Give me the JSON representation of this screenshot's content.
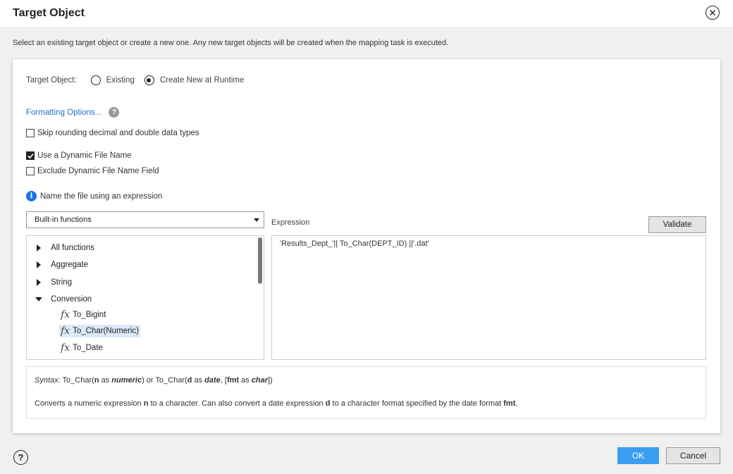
{
  "dialog": {
    "title": "Target Object",
    "description": "Select an existing target object or create a new one. Any new target objects will be created when the mapping task is executed."
  },
  "target_object": {
    "label": "Target Object:",
    "options": [
      {
        "label": "Existing",
        "checked": false
      },
      {
        "label": "Create New at Runtime",
        "checked": true
      }
    ]
  },
  "formatting": {
    "link_label": "Formatting Options...",
    "help_glyph": "?"
  },
  "checkboxes": {
    "skip_rounding": {
      "label": "Skip rounding decimal and double data types",
      "checked": false
    },
    "dynamic_file_name": {
      "label": "Use a Dynamic File Name",
      "checked": true
    },
    "exclude_dynamic": {
      "label": "Exclude Dynamic File Name Field",
      "checked": false
    }
  },
  "info": {
    "icon_glyph": "i",
    "text": "Name the file using an expression"
  },
  "functions": {
    "selected": "Built-in functions",
    "tree": [
      {
        "label": "All functions",
        "expanded": false
      },
      {
        "label": "Aggregate",
        "expanded": false
      },
      {
        "label": "String",
        "expanded": false
      },
      {
        "label": "Conversion",
        "expanded": true
      }
    ],
    "fx_glyph": "fx",
    "items": [
      {
        "label": "To_Bigint",
        "selected": false
      },
      {
        "label": "To_Char(Numeric)",
        "selected": true
      },
      {
        "label": "To_Date",
        "selected": false
      }
    ]
  },
  "expression": {
    "label": "Expression",
    "validate_label": "Validate",
    "value": "'Results_Dept_'|| To_Char(DEPT_ID) ||'.dat'"
  },
  "syntax": {
    "prefix": "Syntax:",
    "p1": " To_Char(",
    "n": "n",
    "as1": " as ",
    "numeric": "numeric",
    "p2": ") or To_Char(",
    "d": "d",
    "as2": " as ",
    "date": "date",
    "p3": ", [",
    "fmt": "fmt",
    "as3": " as ",
    "char": "char",
    "p4": "])",
    "desc1": "Converts a numeric expression ",
    "desc_n": "n",
    "desc2": " to a character. Can also convert a date expression ",
    "desc_d": "d",
    "desc3": " to a character format specified by the date format ",
    "desc_fmt": "fmt",
    "desc4": "."
  },
  "footer": {
    "help_glyph": "?",
    "ok_label": "OK",
    "cancel_label": "Cancel"
  },
  "colors": {
    "accent": "#3b9ef0",
    "link": "#1a73c8",
    "selection": "#dbe9f8"
  }
}
